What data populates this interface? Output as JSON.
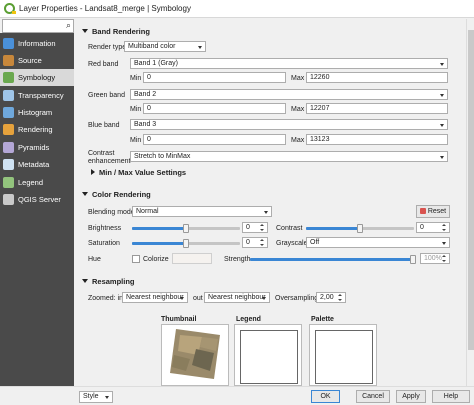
{
  "window": {
    "title": "Layer Properties - Landsat8_merge | Symbology"
  },
  "sidebar": {
    "search_icon": "search-icon",
    "items": [
      {
        "label": "Information",
        "icon": "info-icon",
        "color": "#4a90d9"
      },
      {
        "label": "Source",
        "icon": "source-icon",
        "color": "#c7873b"
      },
      {
        "label": "Symbology",
        "icon": "symbology-icon",
        "color": "#6aa84f"
      },
      {
        "label": "Transparency",
        "icon": "transparency-icon",
        "color": "#9fc5e8"
      },
      {
        "label": "Histogram",
        "icon": "histogram-icon",
        "color": "#6fa8dc"
      },
      {
        "label": "Rendering",
        "icon": "rendering-icon",
        "color": "#e6a23c"
      },
      {
        "label": "Pyramids",
        "icon": "pyramids-icon",
        "color": "#b4a7d6"
      },
      {
        "label": "Metadata",
        "icon": "metadata-icon",
        "color": "#cfe2f3"
      },
      {
        "label": "Legend",
        "icon": "legend-icon",
        "color": "#93c47d"
      },
      {
        "label": "QGIS Server",
        "icon": "server-icon",
        "color": "#c9c9c9"
      }
    ]
  },
  "band_rendering": {
    "header": "Band Rendering",
    "render_type_label": "Render type",
    "render_type": "Multiband color",
    "red": {
      "label": "Red band",
      "band": "Band 1 (Gray)",
      "min": "0",
      "max": "12260"
    },
    "green": {
      "label": "Green band",
      "band": "Band 2",
      "min": "0",
      "max": "12207"
    },
    "blue": {
      "label": "Blue band",
      "band": "Band 3",
      "min": "0",
      "max": "13123"
    },
    "min_label": "Min",
    "max_label": "Max",
    "contrast_label": "Contrast\nenhancement",
    "contrast": "Stretch to MinMax",
    "minmax_settings": "Min / Max Value Settings"
  },
  "color_rendering": {
    "header": "Color Rendering",
    "blending_label": "Blending mode",
    "blending": "Normal",
    "reset_label": "Reset",
    "brightness_label": "Brightness",
    "brightness": "0",
    "brightness_level": 0.5,
    "contrast_label": "Contrast",
    "contrast": "0",
    "contrast_level": 0.5,
    "saturation_label": "Saturation",
    "saturation": "0",
    "saturation_level": 0.5,
    "grayscale_label": "Grayscale",
    "grayscale": "Off",
    "hue_label": "Hue",
    "colorize_label": "Colorize",
    "strength_label": "Strength",
    "strength": "100%",
    "strength_level": 1.0
  },
  "resampling": {
    "header": "Resampling",
    "zoomed_in_label": "Zoomed: in",
    "zoomed_in": "Nearest neighbour",
    "out_label": "out",
    "zoomed_out": "Nearest neighbour",
    "oversampling_label": "Oversampling",
    "oversampling": "2,00"
  },
  "previews": {
    "thumbnail": "Thumbnail",
    "legend": "Legend",
    "palette": "Palette"
  },
  "footer": {
    "style": "Style",
    "ok": "OK",
    "cancel": "Cancel",
    "apply": "Apply",
    "help": "Help"
  }
}
